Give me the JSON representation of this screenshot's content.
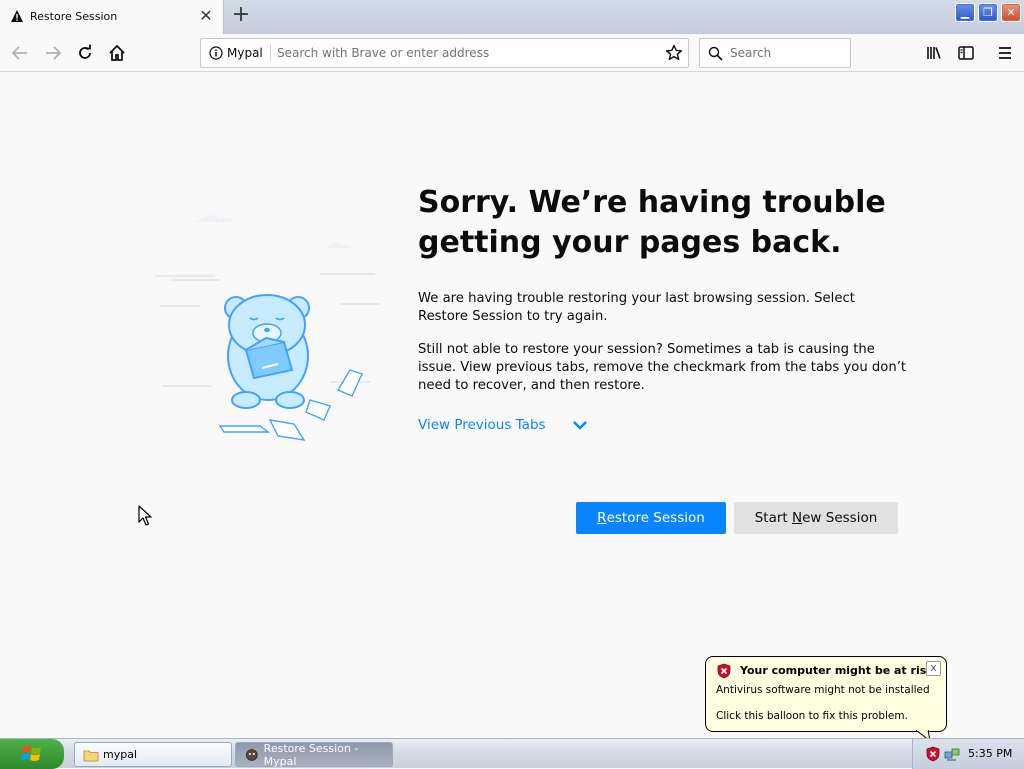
{
  "browser": {
    "tab": {
      "title": "Restore Session",
      "icon": "warning-icon",
      "close_glyph": "✕"
    },
    "new_tab_glyph": "+",
    "window_buttons": {
      "minimize": "▁",
      "maximize": "❐",
      "close": "✕"
    },
    "nav": {
      "back": "back-arrow-icon",
      "forward": "forward-arrow-icon",
      "reload": "reload-icon",
      "home": "home-icon"
    },
    "urlbar": {
      "identity_label": "Mypal",
      "placeholder": "Search with Brave or enter address",
      "value": ""
    },
    "searchbar": {
      "placeholder": "Search",
      "value": ""
    },
    "toolbar_icons": [
      "library-icon",
      "sidebar-icon",
      "menu-icon"
    ]
  },
  "page": {
    "title": "Sorry. We’re having trouble getting your pages back.",
    "paragraph1": "We are having trouble restoring your last browsing session. Select Restore Session to try again.",
    "paragraph2": "Still not able to restore your session? Sometimes a tab is causing the issue. View previous tabs, remove the checkmark from the tabs you don’t need to recover, and then restore.",
    "view_previous_tabs": "View Previous Tabs",
    "restore_button": {
      "prefix": "",
      "accesskey": "R",
      "suffix": "estore Session"
    },
    "new_session_button": {
      "prefix": "Start ",
      "accesskey": "N",
      "suffix": "ew Session"
    },
    "accent_color": "#0a84ff"
  },
  "balloon": {
    "title": "Your computer might be at risk",
    "line1": "Antivirus software might not be installed",
    "line2": "Click this balloon to fix this problem.",
    "close_glyph": "x"
  },
  "taskbar": {
    "start_icon": "windows-logo-icon",
    "tasks": [
      {
        "label": "mypal",
        "icon": "folder-icon"
      },
      {
        "label": "Restore Session - Mypal",
        "icon": "mypal-app-icon"
      }
    ],
    "clock": "5:35 PM"
  }
}
